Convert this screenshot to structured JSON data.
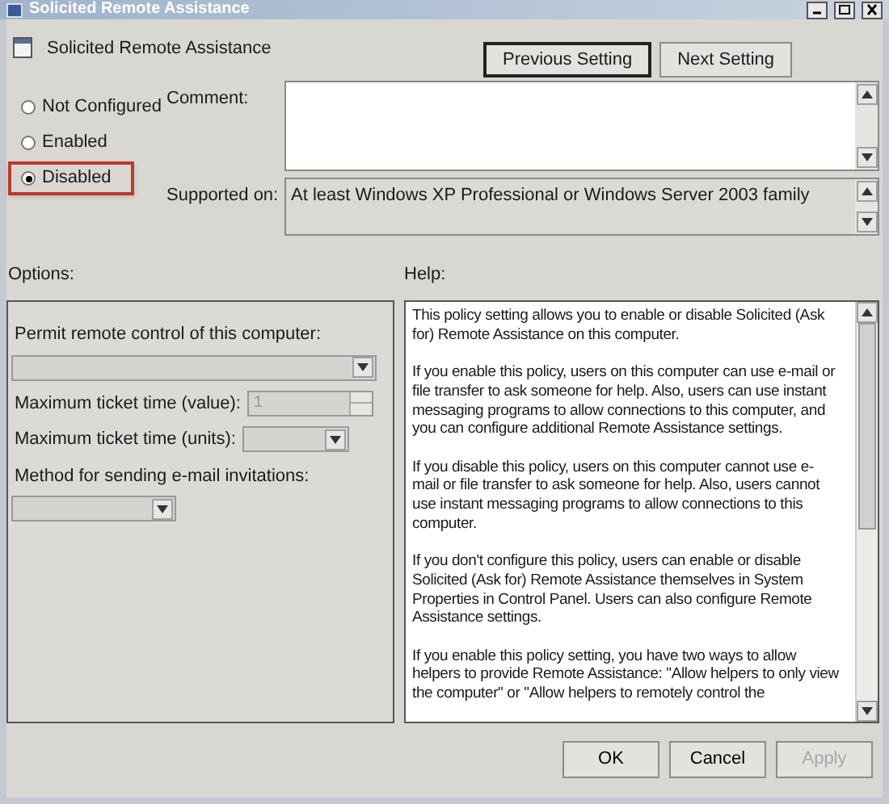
{
  "window": {
    "title": "Solicited Remote Assistance"
  },
  "header": {
    "title": "Solicited Remote Assistance"
  },
  "nav_buttons": [
    {
      "label": "Previous Setting",
      "focused": true
    },
    {
      "label": "Next Setting",
      "focused": false
    }
  ],
  "state_options": [
    {
      "label": "Not Configured",
      "selected": false,
      "highlighted": false
    },
    {
      "label": "Enabled",
      "selected": false,
      "highlighted": false
    },
    {
      "label": "Disabled",
      "selected": true,
      "highlighted": true
    }
  ],
  "comment": {
    "label": "Comment:"
  },
  "supported_on": {
    "label": "Supported on:",
    "value": "At least Windows XP Professional or Windows Server 2003 family"
  },
  "options": {
    "label": "Options:",
    "controls": [
      {
        "kind": "dropdown",
        "label": "Permit remote control of this computer:",
        "disabled": true
      },
      {
        "kind": "spinner",
        "label": "Maximum ticket time (value):",
        "value": "1",
        "disabled": true
      },
      {
        "kind": "inline_dropdown",
        "label": "Maximum ticket time (units):",
        "disabled": true
      },
      {
        "kind": "dropdown",
        "label": "Method for sending e-mail invitations:",
        "disabled": true
      }
    ]
  },
  "help": {
    "label": "Help:",
    "paragraphs": [
      [
        "This policy setting allows you to enable or disable Solicited (Ask",
        "for) Remote Assistance on this computer."
      ],
      [
        "If you enable this policy, users on this computer can use e-mail or",
        "file transfer to ask someone for help. Also, users can use instant",
        "messaging programs to allow connections to this computer, and",
        "you can configure additional Remote Assistance settings."
      ],
      [
        "If you disable this policy, users on this computer cannot use e-",
        "mail or file transfer to ask someone for help. Also, users cannot",
        "use instant messaging programs to allow connections to this",
        "computer."
      ],
      [
        "If you don't configure this policy, users can enable or disable",
        "Solicited (Ask for) Remote Assistance themselves in System",
        "Properties in Control Panel. Users can also configure Remote",
        "Assistance settings."
      ],
      [
        "If you enable this policy setting, you have two ways to allow",
        "helpers to provide Remote Assistance: \"Allow helpers to only view",
        "the computer\" or \"Allow helpers to remotely control the"
      ]
    ]
  },
  "footer_buttons": [
    {
      "label": "OK",
      "disabled": false
    },
    {
      "label": "Cancel",
      "disabled": false
    },
    {
      "label": "Apply",
      "disabled": true
    }
  ]
}
